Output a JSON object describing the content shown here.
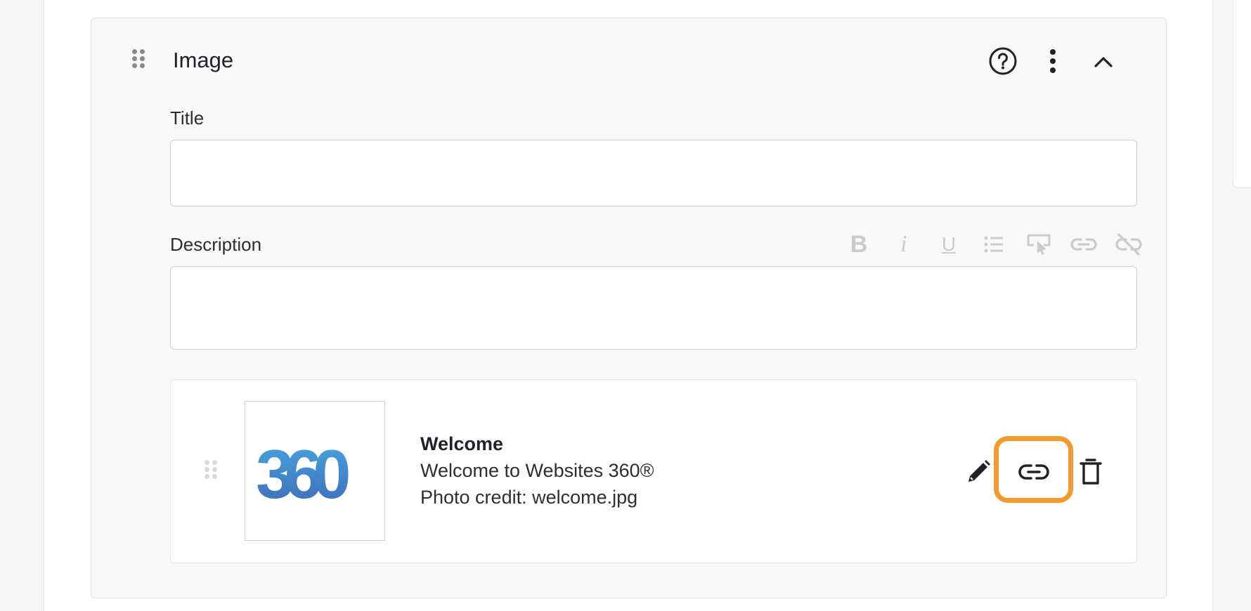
{
  "block": {
    "title": "Image",
    "help_icon": "help-circle-icon",
    "more_icon": "more-vertical-icon",
    "collapse_icon": "chevron-up-icon"
  },
  "fields": {
    "title_label": "Title",
    "title_value": "",
    "description_label": "Description",
    "description_value": ""
  },
  "toolbar": {
    "items": [
      "bold-icon",
      "italic-icon",
      "underline-icon",
      "bulleted-list-icon",
      "cursor-select-icon",
      "link-icon",
      "unlink-icon"
    ],
    "bold": "B",
    "italic": "i",
    "underline": "U"
  },
  "media": {
    "title": "Welcome",
    "caption": "Welcome to Websites 360®",
    "credit": "Photo credit: welcome.jpg",
    "logo_text": "360",
    "actions": [
      "edit-icon",
      "link-icon",
      "trash-icon"
    ]
  },
  "colors": {
    "highlight": "#f39b2f",
    "logo_blue": "#3f7fd0",
    "toolbar_disabled": "#cbcbcb"
  }
}
